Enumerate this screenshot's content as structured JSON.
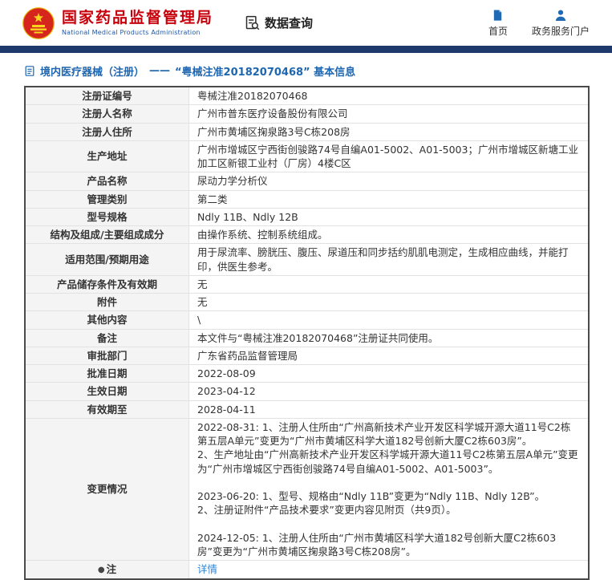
{
  "header": {
    "agency_name_cn": "国家药品监督管理局",
    "agency_name_en": "National Medical Products Administration",
    "section_label": "数据查询",
    "nav_home": "首页",
    "nav_portal": "政务服务门户"
  },
  "breadcrumb": {
    "category": "境内医疗器械（注册）",
    "separator": "——",
    "title": "“粤械注准20182070468” 基本信息"
  },
  "colors": {
    "brand_red": "#c7000b",
    "navy_bar": "#1e3a6d",
    "breadcrumb_blue": "#1f66b0",
    "link_blue": "#2f85d5",
    "label_cell_bg": "#f4f4f4"
  },
  "table": {
    "rows": [
      {
        "label": "注册证编号",
        "value": "粤械注准20182070468"
      },
      {
        "label": "注册人名称",
        "value": "广州市普东医疗设备股份有限公司"
      },
      {
        "label": "注册人住所",
        "value": "广州市黄埔区掬泉路3号C栋208房"
      },
      {
        "label": "生产地址",
        "value": "广州市增城区宁西街创骏路74号自编A01-5002、A01-5003；广州市增城区新塘工业加工区新银工业村（厂房）4楼C区"
      },
      {
        "label": "产品名称",
        "value": "尿动力学分析仪"
      },
      {
        "label": "管理类别",
        "value": "第二类"
      },
      {
        "label": "型号规格",
        "value": "Ndly 11B、Ndly 12B"
      },
      {
        "label": "结构及组成/主要组成成分",
        "value": "由操作系统、控制系统组成。"
      },
      {
        "label": "适用范围/预期用途",
        "value": "用于尿流率、膀胱压、腹压、尿道压和同步括约肌肌电测定，生成相应曲线，并能打印，供医生参考。"
      },
      {
        "label": "产品储存条件及有效期",
        "value": "无"
      },
      {
        "label": "附件",
        "value": "无"
      },
      {
        "label": "其他内容",
        "value": "\\"
      },
      {
        "label": "备注",
        "value": "本文件与“粤械注准20182070468”注册证共同使用。"
      },
      {
        "label": "审批部门",
        "value": "广东省药品监督管理局"
      },
      {
        "label": "批准日期",
        "value": "2022-08-09"
      },
      {
        "label": "生效日期",
        "value": "2023-04-12"
      },
      {
        "label": "有效期至",
        "value": "2028-04-11"
      },
      {
        "label": "变更情况",
        "value": "2022-08-31: 1、注册人住所由“广州高新技术产业开发区科学城开源大道11号C2栋第五层A单元”变更为“广州市黄埔区科学大道182号创新大厦C2栋603房”。\n2、生产地址由“广州高新技术产业开发区科学城开源大道11号C2栋第五层A单元”变更为“广州市增城区宁西街创骏路74号自编A01-5002、A01-5003”。\n\n2023-06-20: 1、型号、规格由“Ndly 11B”变更为“Ndly 11B、Ndly 12B”。\n2、注册证附件“产品技术要求”变更内容见附页（共9页）。\n\n2024-12-05: 1、注册人住所由“广州市黄埔区科学大道182号创新大厦C2栋603房”变更为“广州市黄埔区掬泉路3号C栋208房”。"
      },
      {
        "label": "注",
        "value": "详情"
      }
    ]
  }
}
